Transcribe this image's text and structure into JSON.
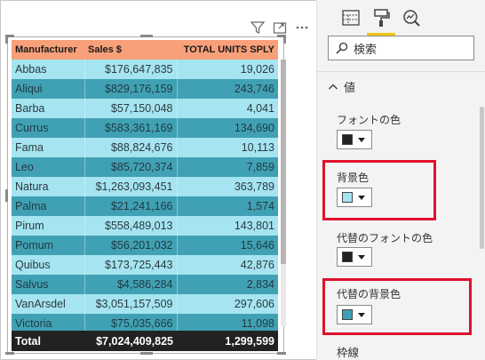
{
  "visual": {
    "icons": [
      "filter-icon",
      "focus-mode-icon",
      "more-options-icon"
    ],
    "columns": [
      "Manufacturer",
      "Sales $",
      "TOTAL UNITS SPLY"
    ],
    "rows": [
      [
        "Abbas",
        "$176,647,835",
        "19,026"
      ],
      [
        "Aliqui",
        "$829,176,159",
        "243,746"
      ],
      [
        "Barba",
        "$57,150,048",
        "4,041"
      ],
      [
        "Currus",
        "$583,361,169",
        "134,690"
      ],
      [
        "Fama",
        "$88,824,676",
        "10,113"
      ],
      [
        "Leo",
        "$85,720,374",
        "7,859"
      ],
      [
        "Natura",
        "$1,263,093,451",
        "363,789"
      ],
      [
        "Palma",
        "$21,241,166",
        "1,574"
      ],
      [
        "Pirum",
        "$558,489,013",
        "143,801"
      ],
      [
        "Pomum",
        "$56,201,032",
        "15,646"
      ],
      [
        "Quibus",
        "$173,725,443",
        "42,876"
      ],
      [
        "Salvus",
        "$4,586,284",
        "2,834"
      ],
      [
        "VanArsdel",
        "$3,051,157,509",
        "297,606"
      ],
      [
        "Victoria",
        "$75,035,666",
        "11,098"
      ]
    ],
    "total": {
      "label": "Total",
      "sales": "$7,024,409,825",
      "units": "1,299,599"
    },
    "colors": {
      "header": "#f7a07a",
      "row_a": "#a5e4f0",
      "row_b": "#41a1b4",
      "total": "#222222"
    }
  },
  "pane": {
    "tabs": [
      "fields-icon",
      "format-paint-icon",
      "analytics-icon"
    ],
    "active_tab": "format-paint-icon",
    "search": {
      "placeholder": "検索"
    },
    "section": "値",
    "properties": [
      {
        "label": "フォントの色",
        "color": "#222222",
        "highlighted": false
      },
      {
        "label": "背景色",
        "color": "#a5e4f0",
        "highlighted": true
      },
      {
        "label": "代替のフォントの色",
        "color": "#222222",
        "highlighted": false
      },
      {
        "label": "代替の背景色",
        "color": "#41a1b4",
        "highlighted": true
      }
    ],
    "next_section": "枠線",
    "highlight_color": "#e0102d"
  }
}
